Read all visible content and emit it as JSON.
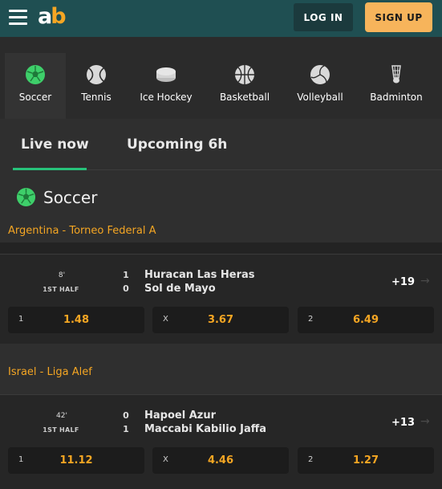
{
  "header": {
    "logo_a": "a",
    "logo_b": "b",
    "login_label": "LOG IN",
    "signup_label": "SIGN UP"
  },
  "sports": [
    {
      "label": "Soccer",
      "icon": "soccer-ball-icon",
      "active": true
    },
    {
      "label": "Tennis",
      "icon": "tennis-ball-icon"
    },
    {
      "label": "Ice Hockey",
      "icon": "hockey-puck-icon"
    },
    {
      "label": "Basketball",
      "icon": "basketball-icon"
    },
    {
      "label": "Volleyball",
      "icon": "volleyball-icon"
    },
    {
      "label": "Badminton",
      "icon": "shuttlecock-icon"
    }
  ],
  "tabs": {
    "live": "Live now",
    "upcoming": "Upcoming 6h",
    "active_color": "#27c27a"
  },
  "section": {
    "title": "Soccer"
  },
  "colors": {
    "brand": "#1f4f52",
    "accent": "#f5a623",
    "signup": "#f7b45b",
    "live_green": "#27c27a"
  },
  "events": [
    {
      "league": "Argentina - Torneo Federal A",
      "time": "8'",
      "phase": "1ST HALF",
      "home": {
        "name": "Huracan Las Heras",
        "score": "1"
      },
      "away": {
        "name": "Sol de Mayo",
        "score": "0"
      },
      "more_markets": "+19",
      "odds": [
        {
          "key": "1",
          "value": "1.48"
        },
        {
          "key": "X",
          "value": "3.67"
        },
        {
          "key": "2",
          "value": "6.49"
        }
      ]
    },
    {
      "league": "Israel - Liga Alef",
      "time": "42'",
      "phase": "1ST HALF",
      "home": {
        "name": "Hapoel Azur",
        "score": "0"
      },
      "away": {
        "name": "Maccabi Kabilio Jaffa",
        "score": "1"
      },
      "more_markets": "+13",
      "odds": [
        {
          "key": "1",
          "value": "11.12"
        },
        {
          "key": "X",
          "value": "4.46"
        },
        {
          "key": "2",
          "value": "1.27"
        }
      ]
    }
  ]
}
